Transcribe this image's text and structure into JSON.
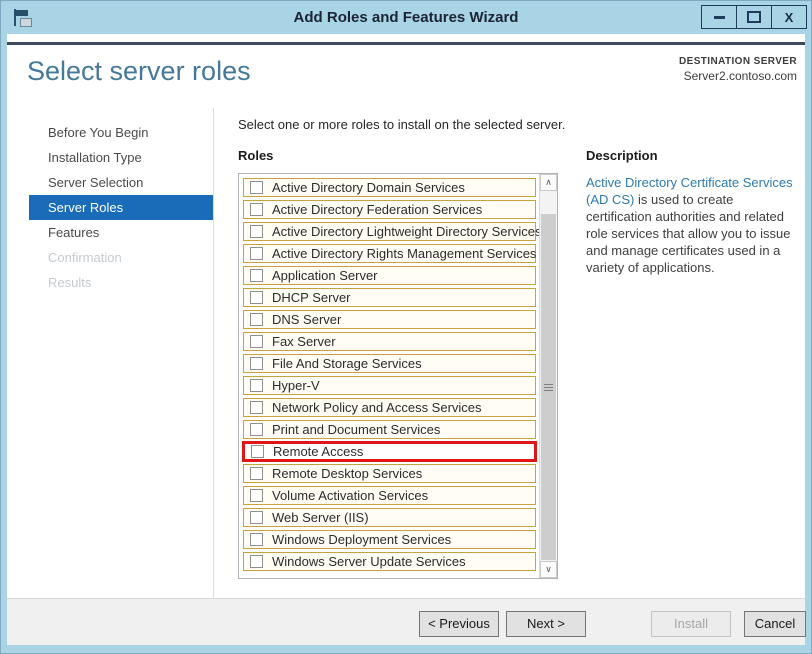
{
  "window": {
    "title": "Add Roles and Features Wizard",
    "controls": {
      "close_glyph": "X"
    }
  },
  "icons": {
    "scroll_up": "∧",
    "scroll_down": "∨"
  },
  "header": {
    "title": "Select server roles",
    "destination_label": "DESTINATION SERVER",
    "destination_server": "Server2.contoso.com"
  },
  "sidebar": {
    "items": [
      {
        "label": "Before You Begin",
        "state": "normal"
      },
      {
        "label": "Installation Type",
        "state": "normal"
      },
      {
        "label": "Server Selection",
        "state": "normal"
      },
      {
        "label": "Server Roles",
        "state": "selected"
      },
      {
        "label": "Features",
        "state": "normal"
      },
      {
        "label": "Confirmation",
        "state": "disabled"
      },
      {
        "label": "Results",
        "state": "disabled"
      }
    ]
  },
  "main": {
    "instruction": "Select one or more roles to install on the selected server.",
    "roles_label": "Roles",
    "roles": [
      {
        "label": "Active Directory Domain Services",
        "checked": false,
        "highlighted": false
      },
      {
        "label": "Active Directory Federation Services",
        "checked": false,
        "highlighted": false
      },
      {
        "label": "Active Directory Lightweight Directory Services",
        "checked": false,
        "highlighted": false
      },
      {
        "label": "Active Directory Rights Management Services",
        "checked": false,
        "highlighted": false
      },
      {
        "label": "Application Server",
        "checked": false,
        "highlighted": false
      },
      {
        "label": "DHCP Server",
        "checked": false,
        "highlighted": false
      },
      {
        "label": "DNS Server",
        "checked": false,
        "highlighted": false
      },
      {
        "label": "Fax Server",
        "checked": false,
        "highlighted": false
      },
      {
        "label": "File And Storage Services",
        "checked": false,
        "highlighted": false
      },
      {
        "label": "Hyper-V",
        "checked": false,
        "highlighted": false
      },
      {
        "label": "Network Policy and Access Services",
        "checked": false,
        "highlighted": false
      },
      {
        "label": "Print and Document Services",
        "checked": false,
        "highlighted": false
      },
      {
        "label": "Remote Access",
        "checked": false,
        "highlighted": true
      },
      {
        "label": "Remote Desktop Services",
        "checked": false,
        "highlighted": false
      },
      {
        "label": "Volume Activation Services",
        "checked": false,
        "highlighted": false
      },
      {
        "label": "Web Server (IIS)",
        "checked": false,
        "highlighted": false
      },
      {
        "label": "Windows Deployment Services",
        "checked": false,
        "highlighted": false
      },
      {
        "label": "Windows Server Update Services",
        "checked": false,
        "highlighted": false
      }
    ]
  },
  "description": {
    "heading": "Description",
    "link_text": "Active Directory Certificate Services (AD CS)",
    "body_text": " is used to create certification authorities and related role services that allow you to issue and manage certificates used in a variety of applications."
  },
  "footer": {
    "buttons": [
      {
        "label": "< Previous",
        "enabled": true
      },
      {
        "label": "Next >",
        "enabled": true
      },
      {
        "label": "Install",
        "enabled": false
      },
      {
        "label": "Cancel",
        "enabled": true
      }
    ]
  },
  "colors": {
    "titlebar": "#a9d4e5",
    "selected_nav": "#1a6cb8",
    "page_title": "#45799a",
    "role_row_border": "#c7a23e",
    "highlight_red": "#e01616",
    "link": "#2e7cab"
  }
}
